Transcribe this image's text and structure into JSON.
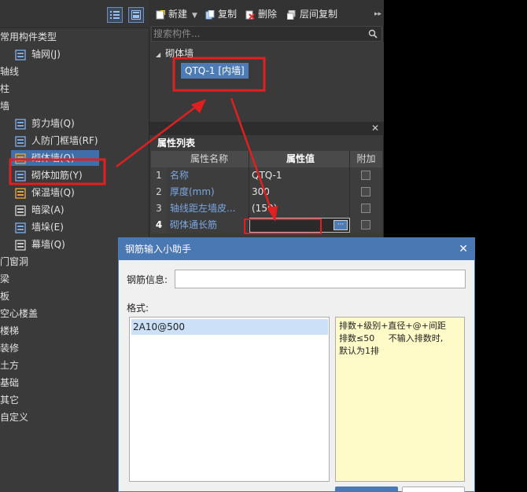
{
  "left_tree": {
    "items": [
      {
        "label": "常用构件类型",
        "level": 0
      },
      {
        "label": "轴网(J)",
        "level": 1
      },
      {
        "label": "轴线",
        "level": 0
      },
      {
        "label": "柱",
        "level": 0
      },
      {
        "label": "墙",
        "level": 0
      },
      {
        "label": "剪力墙(Q)",
        "level": 1
      },
      {
        "label": "人防门框墙(RF)",
        "level": 1
      },
      {
        "label": "砌体墙(Q)",
        "level": 1
      },
      {
        "label": "砌体加筋(Y)",
        "level": 1
      },
      {
        "label": "保温墙(Q)",
        "level": 1
      },
      {
        "label": "暗梁(A)",
        "level": 1
      },
      {
        "label": "墙垛(E)",
        "level": 1
      },
      {
        "label": "幕墙(Q)",
        "level": 1
      },
      {
        "label": "门窗洞",
        "level": 0
      },
      {
        "label": "梁",
        "level": 0
      },
      {
        "label": "板",
        "level": 0
      },
      {
        "label": "空心楼盖",
        "level": 0
      },
      {
        "label": "楼梯",
        "level": 0
      },
      {
        "label": "装修",
        "level": 0
      },
      {
        "label": "土方",
        "level": 0
      },
      {
        "label": "基础",
        "level": 0
      },
      {
        "label": "其它",
        "level": 0
      },
      {
        "label": "自定义",
        "level": 0
      }
    ]
  },
  "toolbar": {
    "new_label": "新建",
    "copy_label": "复制",
    "delete_label": "删除",
    "floor_copy_label": "层间复制"
  },
  "search": {
    "placeholder": "搜索构件..."
  },
  "type_tree": {
    "group": "砌体墙",
    "item": "QTQ-1 [内墙]"
  },
  "properties": {
    "title": "属性列表",
    "headers": {
      "name": "属性名称",
      "value": "属性值",
      "extra": "附加"
    },
    "rows": [
      {
        "num": "1",
        "name": "名称",
        "value": "QTQ-1"
      },
      {
        "num": "2",
        "name": "厚度(mm)",
        "value": "300"
      },
      {
        "num": "3",
        "name": "轴线距左墙皮...",
        "value": "(150)"
      },
      {
        "num": "4",
        "name": "砌体通长筋",
        "value": ""
      }
    ],
    "more_btn": "···"
  },
  "dialog": {
    "title": "钢筋输入小助手",
    "info_label": "钢筋信息:",
    "info_value": "",
    "format_label": "格式:",
    "format_items": [
      "2A10@500"
    ],
    "help_line1": "排数+级别+直径+@+间距",
    "help_line2": "排数≤50     不输入排数时,",
    "help_line3": "默认为1排"
  },
  "colors": {
    "accent": "#4a78b3",
    "selection": "#3f6fa8",
    "annotation": "#e02020"
  }
}
